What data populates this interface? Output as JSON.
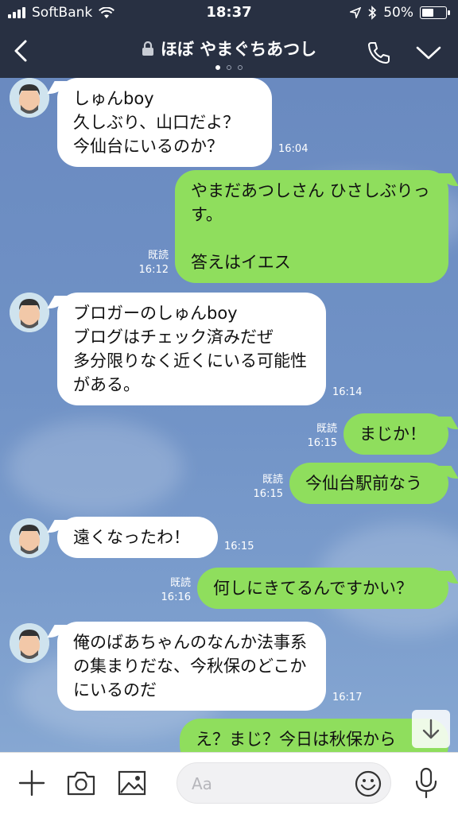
{
  "status_bar": {
    "carrier": "SoftBank",
    "time": "18:37",
    "battery": "50%",
    "battery_level": 0.5
  },
  "header": {
    "title": "ほぼ やまぐちあつし",
    "page_dots": 3,
    "active_dot": 0
  },
  "messages": [
    {
      "side": "left",
      "text": "しゅんboy\n久しぶり、山口だよ？\n今仙台にいるのか？",
      "time": "16:04",
      "read": ""
    },
    {
      "side": "right",
      "text": "やまだあつしさん ひさしぶりっす。\n\n答えはイエス",
      "time": "16:12",
      "read": "既読"
    },
    {
      "side": "left",
      "text": "ブロガーのしゅんboy\nブログはチェック済みだぜ\n多分限りなく近くにいる可能性がある。",
      "time": "16:14",
      "read": ""
    },
    {
      "side": "right",
      "text": "まじか！",
      "time": "16:15",
      "read": "既読"
    },
    {
      "side": "right",
      "text": "今仙台駅前なう",
      "time": "16:15",
      "read": "既読"
    },
    {
      "side": "left",
      "text": "遠くなったわ！",
      "time": "16:15",
      "read": ""
    },
    {
      "side": "right",
      "text": "何しにきてるんですかい？",
      "time": "16:16",
      "read": "既読"
    },
    {
      "side": "left",
      "text": "俺のばあちゃんのなんか法事系の集まりだな、今秋保のどこかにいるのだ",
      "time": "16:17",
      "read": ""
    },
    {
      "side": "right",
      "text": "え？まじ？今日は秋保から",
      "time": "",
      "read": ""
    }
  ],
  "input": {
    "placeholder": "Aa"
  },
  "icons": {
    "back": "chevron-left-icon",
    "lock": "lock-icon",
    "call": "phone-icon",
    "menu": "chevron-down-icon",
    "add": "plus-icon",
    "camera": "camera-icon",
    "image": "image-icon",
    "emoji": "smiley-icon",
    "mic": "microphone-icon",
    "scroll": "arrow-down-icon"
  },
  "colors": {
    "header_bg": "#283042",
    "chat_bg": "#7092c6",
    "bubble_self": "#8fde5d",
    "bubble_other": "#ffffff"
  }
}
